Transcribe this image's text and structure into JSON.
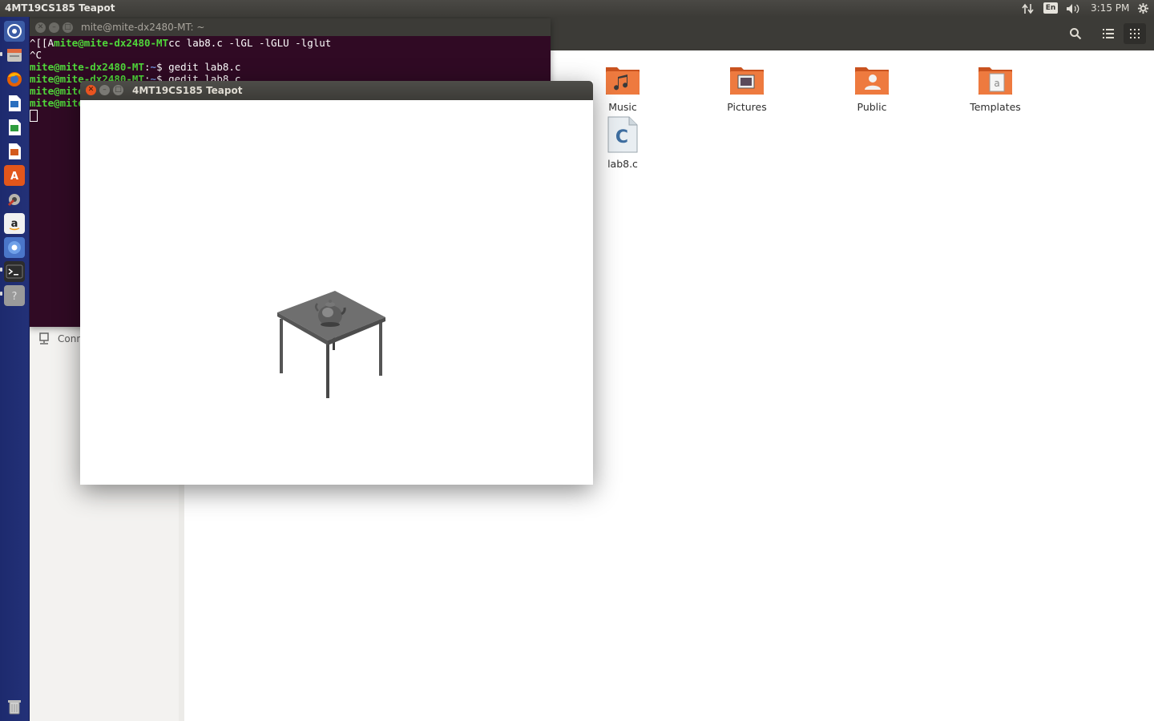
{
  "top_panel": {
    "app_title": "4MT19CS185 Teapot",
    "keyboard_layout": "En",
    "clock": "3:15 PM"
  },
  "launcher": {
    "items": [
      "dash-icon",
      "files-icon",
      "firefox-icon",
      "writer-icon",
      "calc-icon",
      "impress-icon",
      "software-center-icon",
      "system-settings-icon",
      "amazon-icon",
      "chromium-icon",
      "terminal-icon",
      "unknown-app-icon"
    ],
    "trash": "trash-icon"
  },
  "terminal": {
    "title": "mite@mite-dx2480-MT: ~",
    "lines": [
      {
        "pre": "^[[A",
        "user": "mite@mite-dx2480-MT",
        "cmd": "cc lab8.c -lGL -lGLU -lglut"
      },
      {
        "pre": "^C"
      },
      {
        "user": "mite@mite-dx2480-MT",
        "sep": ":",
        "path": "~",
        "cmd": "$ gedit lab8.c"
      },
      {
        "user": "mite@mite-dx2480-MT",
        "sep": ":",
        "path": "~",
        "cmd": "$ gedit lab8.c"
      },
      {
        "user": "mite@mite-dx2480-MT"
      },
      {
        "user": "mite@mite-dx2480-MT"
      }
    ]
  },
  "file_manager": {
    "sidebar": {
      "connect_label": "Connect to Server"
    },
    "files": [
      {
        "name": "Music",
        "icon": "music-folder-icon"
      },
      {
        "name": "Pictures",
        "icon": "pictures-folder-icon"
      },
      {
        "name": "Public",
        "icon": "public-folder-icon"
      },
      {
        "name": "Templates",
        "icon": "templates-folder-icon"
      },
      {
        "name": "lab8.c",
        "icon": "c-source-file-icon"
      }
    ]
  },
  "teapot_window": {
    "title": "4MT19CS185 Teapot"
  }
}
